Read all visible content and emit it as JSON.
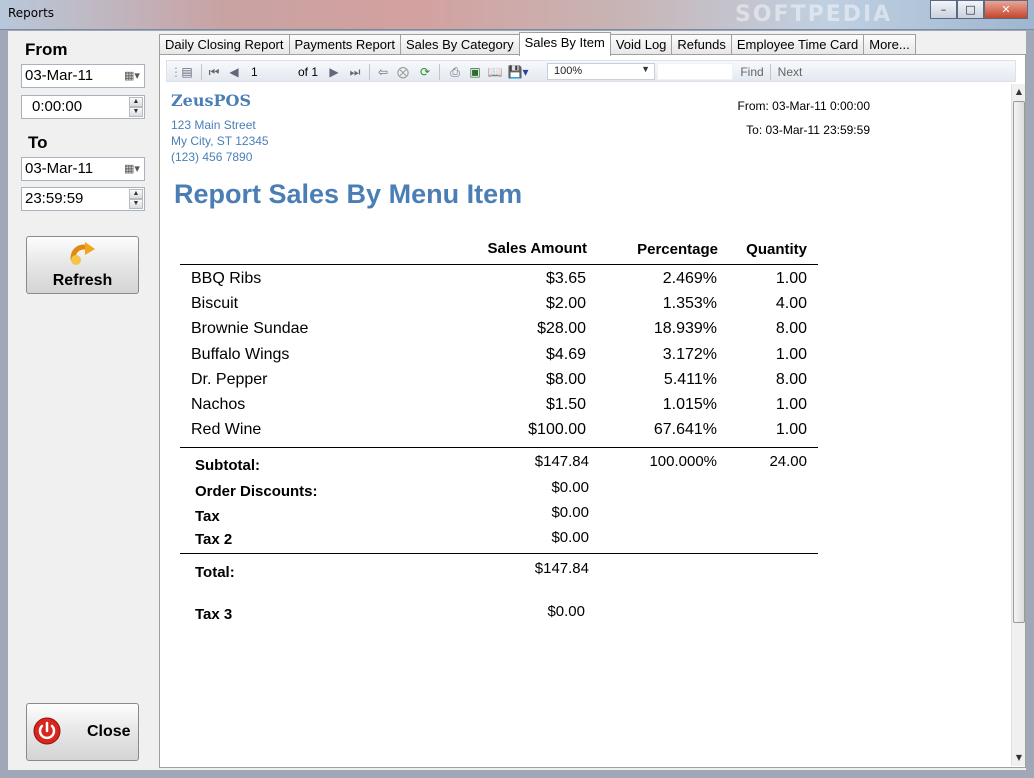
{
  "window": {
    "title": "Reports",
    "watermark": "SOFTPEDIA"
  },
  "left_panel": {
    "from_label": "From",
    "from_date": "03-Mar-11",
    "from_time": "0:00:00",
    "to_label": "To",
    "to_date": "03-Mar-11",
    "to_time": "23:59:59",
    "refresh_label": "Refresh",
    "close_label": "Close"
  },
  "tabs": [
    {
      "label": "Daily Closing Report"
    },
    {
      "label": "Payments Report"
    },
    {
      "label": "Sales By Category"
    },
    {
      "label": "Sales By Item"
    },
    {
      "label": "Void Log"
    },
    {
      "label": "Refunds"
    },
    {
      "label": "Employee Time Card"
    },
    {
      "label": "More..."
    }
  ],
  "active_tab": "Sales By Item",
  "toolbar": {
    "page": "1",
    "page_of": "of 1",
    "zoom": "100%",
    "find_label": "Find",
    "next_label": "Next"
  },
  "report": {
    "company_name": "ZeusPOS",
    "address_line1": "123 Main Street",
    "address_line2": "My City, ST 12345",
    "phone": "(123) 456 7890",
    "from_line": "From: 03-Mar-11 0:00:00",
    "to_line": "To: 03-Mar-11 23:59:59",
    "title": "Report Sales By Menu Item",
    "columns": {
      "amount": "Sales Amount",
      "percentage": "Percentage",
      "quantity": "Quantity"
    },
    "rows": [
      {
        "item": "BBQ Ribs",
        "amount": "$3.65",
        "percentage": "2.469%",
        "quantity": "1.00"
      },
      {
        "item": "Biscuit",
        "amount": "$2.00",
        "percentage": "1.353%",
        "quantity": "4.00"
      },
      {
        "item": "Brownie Sundae",
        "amount": "$28.00",
        "percentage": "18.939%",
        "quantity": "8.00"
      },
      {
        "item": "Buffalo Wings",
        "amount": "$4.69",
        "percentage": "3.172%",
        "quantity": "1.00"
      },
      {
        "item": "Dr. Pepper",
        "amount": "$8.00",
        "percentage": "5.411%",
        "quantity": "8.00"
      },
      {
        "item": "Nachos",
        "amount": "$1.50",
        "percentage": "1.015%",
        "quantity": "1.00"
      },
      {
        "item": "Red Wine",
        "amount": "$100.00",
        "percentage": "67.641%",
        "quantity": "1.00"
      }
    ],
    "subtotal": {
      "label": "Subtotal:",
      "amount": "$147.84",
      "percentage": "100.000%",
      "quantity": "24.00"
    },
    "order_discounts": {
      "label": "Order Discounts:",
      "amount": "$0.00"
    },
    "tax": {
      "label": "Tax",
      "amount": "$0.00"
    },
    "tax2": {
      "label": "Tax 2",
      "amount": "$0.00"
    },
    "total": {
      "label": "Total:",
      "amount": "$147.84"
    },
    "tax3": {
      "label": "Tax 3",
      "amount": "$0.00"
    }
  },
  "colors": {
    "accent": "#4a7eb5",
    "window_bg": "#f0f0f0"
  }
}
